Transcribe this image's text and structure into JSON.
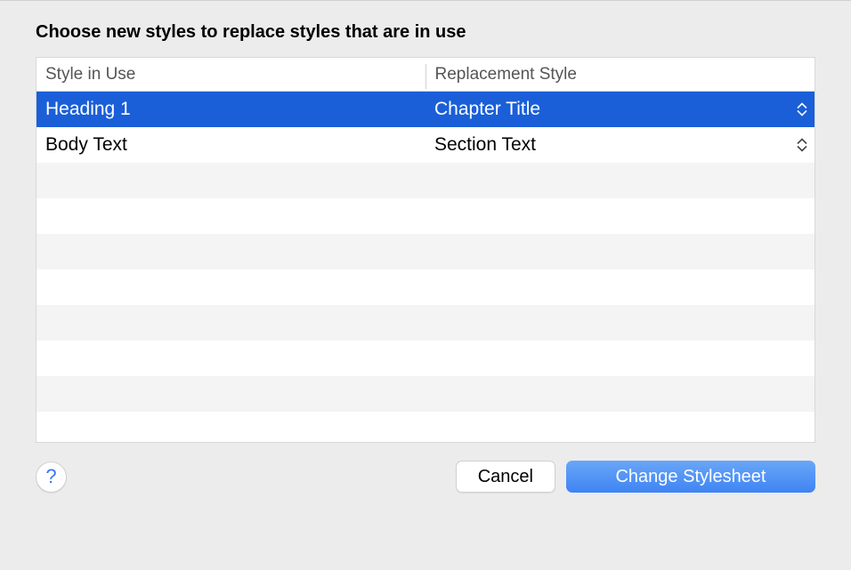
{
  "dialog": {
    "title": "Choose new styles to replace styles that are in use"
  },
  "table": {
    "headers": {
      "col1": "Style in Use",
      "col2": "Replacement Style"
    },
    "rows": [
      {
        "style_in_use": "Heading 1",
        "replacement": "Chapter Title",
        "selected": true
      },
      {
        "style_in_use": "Body Text",
        "replacement": "Section Text",
        "selected": false
      }
    ]
  },
  "footer": {
    "help_label": "?",
    "cancel_label": "Cancel",
    "confirm_label": "Change Stylesheet"
  }
}
